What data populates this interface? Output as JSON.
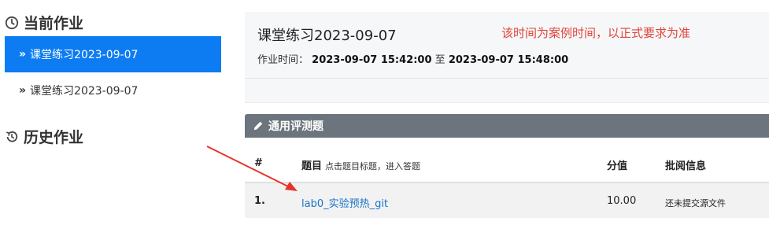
{
  "sidebar": {
    "current_title": "当前作业",
    "items": [
      {
        "chevron": "»",
        "label": "课堂练习2023-09-07",
        "active": true
      },
      {
        "chevron": "»",
        "label": "课堂练习2023-09-07",
        "active": false
      }
    ],
    "history_title": "历史作业",
    "icons": {
      "current": "clock-icon",
      "history": "history-icon"
    }
  },
  "assignment": {
    "title": "课堂练习2023-09-07",
    "note": "该时间为案例时间，以正式要求为准",
    "time_label": "作业时间：",
    "start": "2023-09-07 15:42:00",
    "to": "至",
    "end": "2023-09-07 15:48:00"
  },
  "panel": {
    "icon": "pencil-icon",
    "title": "通用评测题",
    "columns": {
      "num": "#",
      "title": "题目",
      "title_hint": "点击题目标题，进入答题",
      "score": "分值",
      "review": "批阅信息"
    },
    "rows": [
      {
        "num": "1.",
        "title": "lab0_实验预热_git",
        "score": "10.00",
        "review": "还未提交源文件"
      }
    ]
  },
  "colors": {
    "accent": "#0d7cf2",
    "note_red": "#e0453a",
    "link": "#1a73c8",
    "panel_bar": "#6c757d",
    "arrow": "#e5352b"
  }
}
